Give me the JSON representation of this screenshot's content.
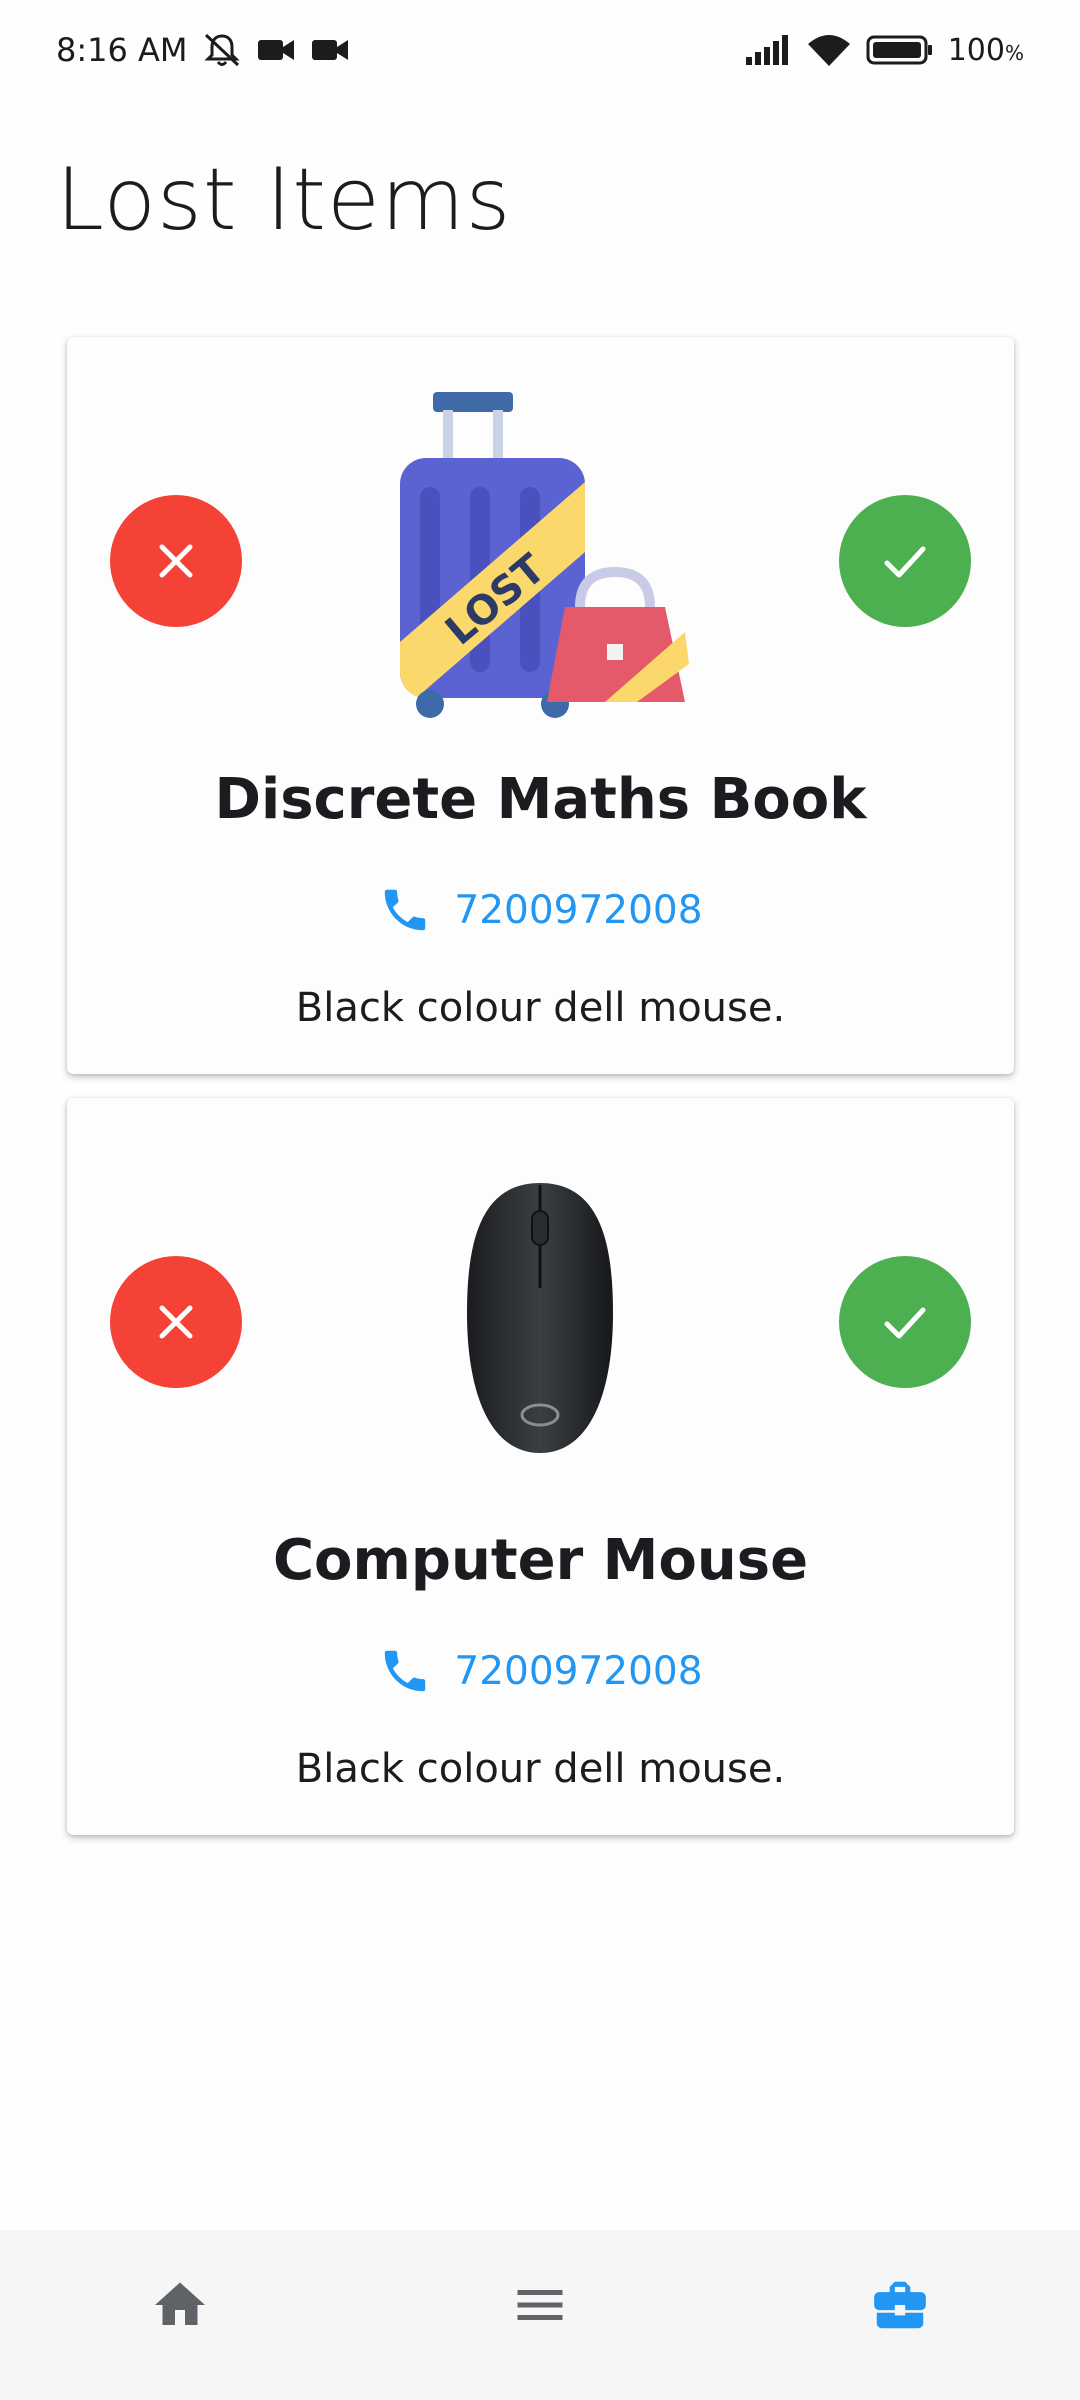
{
  "status_bar": {
    "time": "8:16 AM",
    "battery": "100"
  },
  "page": {
    "title": "Lost Items"
  },
  "items": [
    {
      "name": "Discrete Maths Book",
      "phone": "7200972008",
      "description": "Black colour dell mouse.",
      "image_icon": "lost-luggage-icon",
      "image_text": "LOST"
    },
    {
      "name": "Computer Mouse",
      "phone": "7200972008",
      "description": "Black colour dell mouse.",
      "image_icon": "computer-mouse-icon"
    }
  ],
  "colors": {
    "reject": "#f44336",
    "accept": "#4caf50",
    "accent": "#2196f3"
  },
  "bottom_nav": {
    "items": [
      "home-icon",
      "menu-icon",
      "briefcase-icon"
    ],
    "active": "briefcase-icon"
  }
}
